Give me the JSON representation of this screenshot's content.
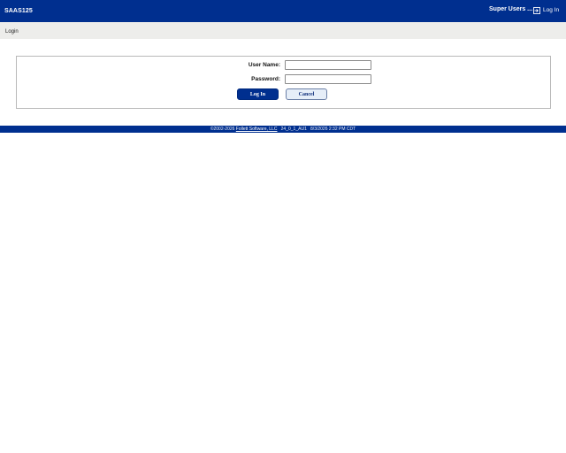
{
  "header": {
    "app_title": "SAAS125",
    "super_users_label": "Super Users ...",
    "login_link_label": "Log In",
    "login_icon": "login-arrow-icon"
  },
  "breadcrumb": {
    "current": "Login"
  },
  "form": {
    "username_label": "User Name:",
    "username_value": "",
    "password_label": "Password:",
    "password_value": "",
    "login_button": "Log In",
    "cancel_button": "Cancel"
  },
  "footer": {
    "copyright": "©2002-2026 ",
    "company_link": "Follett Software, LLC",
    "version": "24_0_1_AU1",
    "timestamp": "8/3/2026 2:32 PM CDT"
  },
  "colors": {
    "brand_blue": "#002f8f",
    "subbar_gray": "#ededeb",
    "cancel_bg": "#e6eef8"
  }
}
